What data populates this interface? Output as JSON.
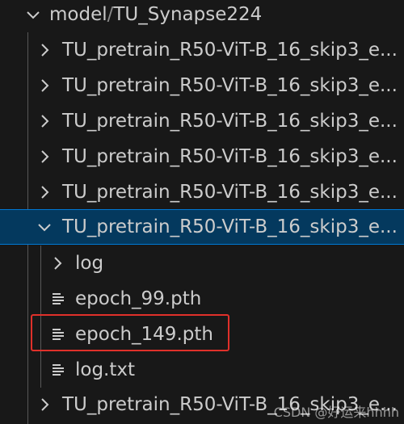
{
  "explorer": {
    "root": {
      "folder": "model",
      "separator": "/",
      "subfolder": "TU_Synapse224"
    },
    "items": [
      {
        "label": "TU_pretrain_R50-ViT-B_16_skip3_e...",
        "type": "folder",
        "expanded": false
      },
      {
        "label": "TU_pretrain_R50-ViT-B_16_skip3_e...",
        "type": "folder",
        "expanded": false
      },
      {
        "label": "TU_pretrain_R50-ViT-B_16_skip3_e...",
        "type": "folder",
        "expanded": false
      },
      {
        "label": "TU_pretrain_R50-ViT-B_16_skip3_e...",
        "type": "folder",
        "expanded": false
      },
      {
        "label": "TU_pretrain_R50-ViT-B_16_skip3_e...",
        "type": "folder",
        "expanded": false
      },
      {
        "label": "TU_pretrain_R50-ViT-B_16_skip3_e...",
        "type": "folder",
        "expanded": true,
        "selected": true
      },
      {
        "label": "log",
        "type": "folder",
        "expanded": false
      },
      {
        "label": "epoch_99.pth",
        "type": "file"
      },
      {
        "label": "epoch_149.pth",
        "type": "file",
        "highlighted": true
      },
      {
        "label": "log.txt",
        "type": "file"
      },
      {
        "label": "TU_pretrain_R50-ViT-B_16_skip3_e...",
        "type": "folder",
        "expanded": false
      }
    ]
  },
  "watermark": "CSDN @好运来hhhh",
  "colors": {
    "background": "#181818",
    "selected_background": "#04395e",
    "selected_border": "#0078d4",
    "text": "#cccccc",
    "highlight_box": "#e0302a"
  },
  "icons": {
    "collapsed": "chevron-right-icon",
    "expanded": "chevron-down-icon",
    "file": "file-lines-icon"
  }
}
